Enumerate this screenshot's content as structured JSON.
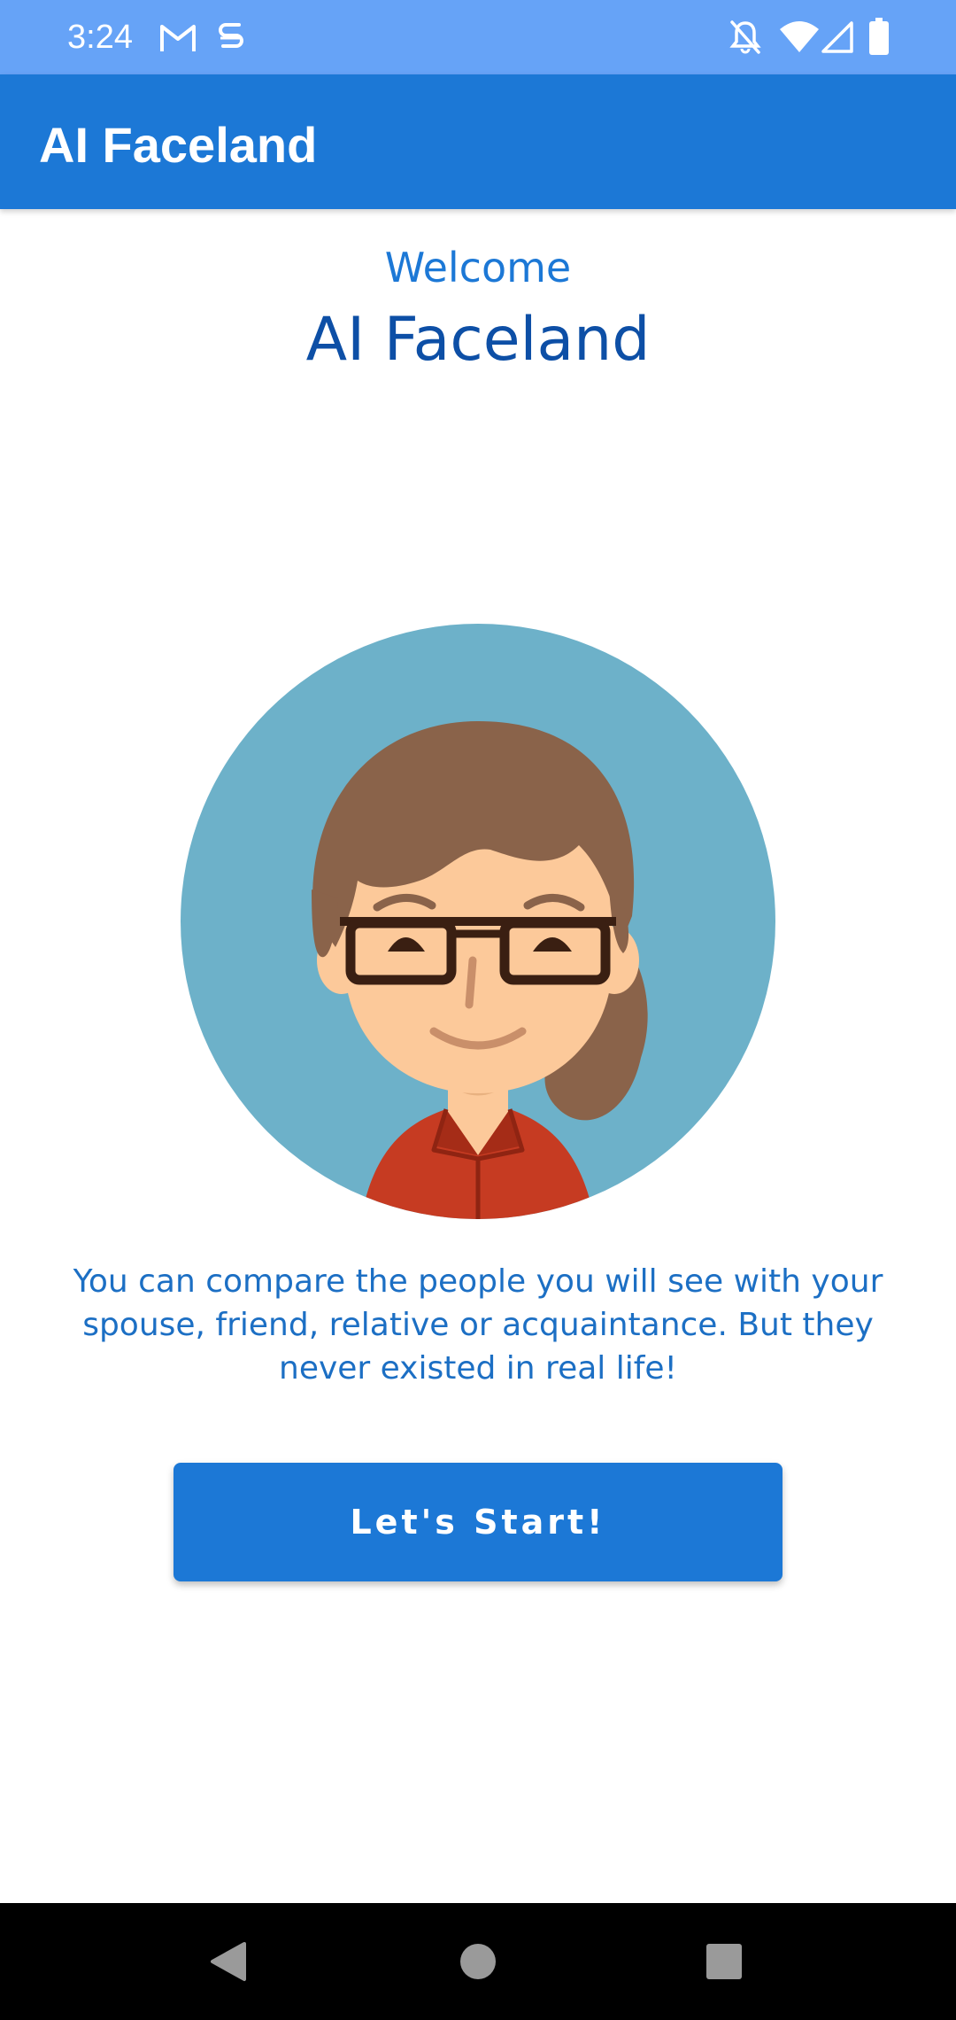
{
  "status_bar": {
    "time": "3:24",
    "icons_left": [
      "gmail-icon",
      "sync-icon"
    ],
    "icons_right": [
      "bell-off-icon",
      "wifi-icon",
      "signal-icon",
      "battery-icon"
    ],
    "background": "#66a3f7"
  },
  "app_bar": {
    "title": "AI Faceland",
    "background": "#1c78d6"
  },
  "main": {
    "welcome_label": "Welcome",
    "welcome_title": "AI Faceland",
    "avatar": "avatar-illustration",
    "description": "You can compare the people you will see with your spouse, friend, relative or acquaintance. But they never existed in real life!",
    "start_button_label": "Let's Start!"
  },
  "nav_bar": {
    "buttons": [
      "back-icon",
      "home-icon",
      "recents-icon"
    ]
  },
  "colors": {
    "primary": "#1c78d6",
    "primary_dark": "#0d4fa6",
    "avatar_bg": "#6db1c9",
    "hair": "#8a634a",
    "skin": "#fcc99a",
    "shirt": "#c63b22"
  }
}
